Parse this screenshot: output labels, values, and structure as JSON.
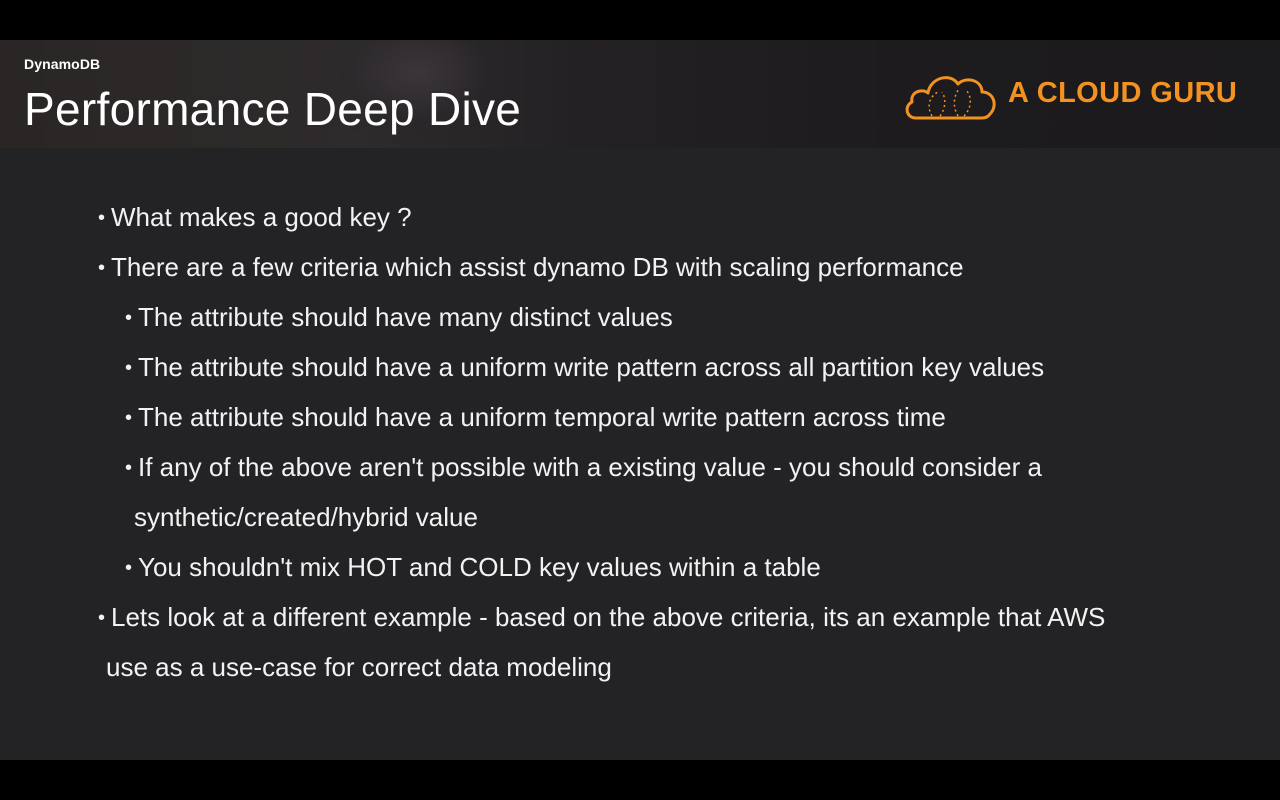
{
  "header": {
    "section": "DynamoDB",
    "title": "Performance Deep Dive",
    "brand": {
      "name": "A CLOUD GURU",
      "color": "#f29220",
      "logo_icon": "cloud-logo-icon"
    }
  },
  "bullets": [
    {
      "level": 1,
      "text": "What makes a good key ?"
    },
    {
      "level": 1,
      "text": "There are a few criteria which assist dynamo DB with scaling performance"
    },
    {
      "level": 2,
      "text": "The attribute should have many distinct values"
    },
    {
      "level": 2,
      "text": "The attribute should have a uniform write pattern across all partition key values"
    },
    {
      "level": 2,
      "text": "The attribute should have a uniform temporal write pattern across time"
    },
    {
      "level": 2,
      "text": "If any of the above aren't possible with a existing value - you should consider a",
      "continuation": "synthetic/created/hybrid value"
    },
    {
      "level": 2,
      "text": "You shouldn't mix HOT and COLD key values within a table"
    },
    {
      "level": 1,
      "text": "Lets look at a different example - based on the above criteria, its an example that AWS",
      "continuation": "use as a use-case for correct data modeling"
    }
  ],
  "colors": {
    "background": "#232326",
    "letterbox": "#000000",
    "text": "#f2f2f2",
    "accent": "#f29220"
  }
}
